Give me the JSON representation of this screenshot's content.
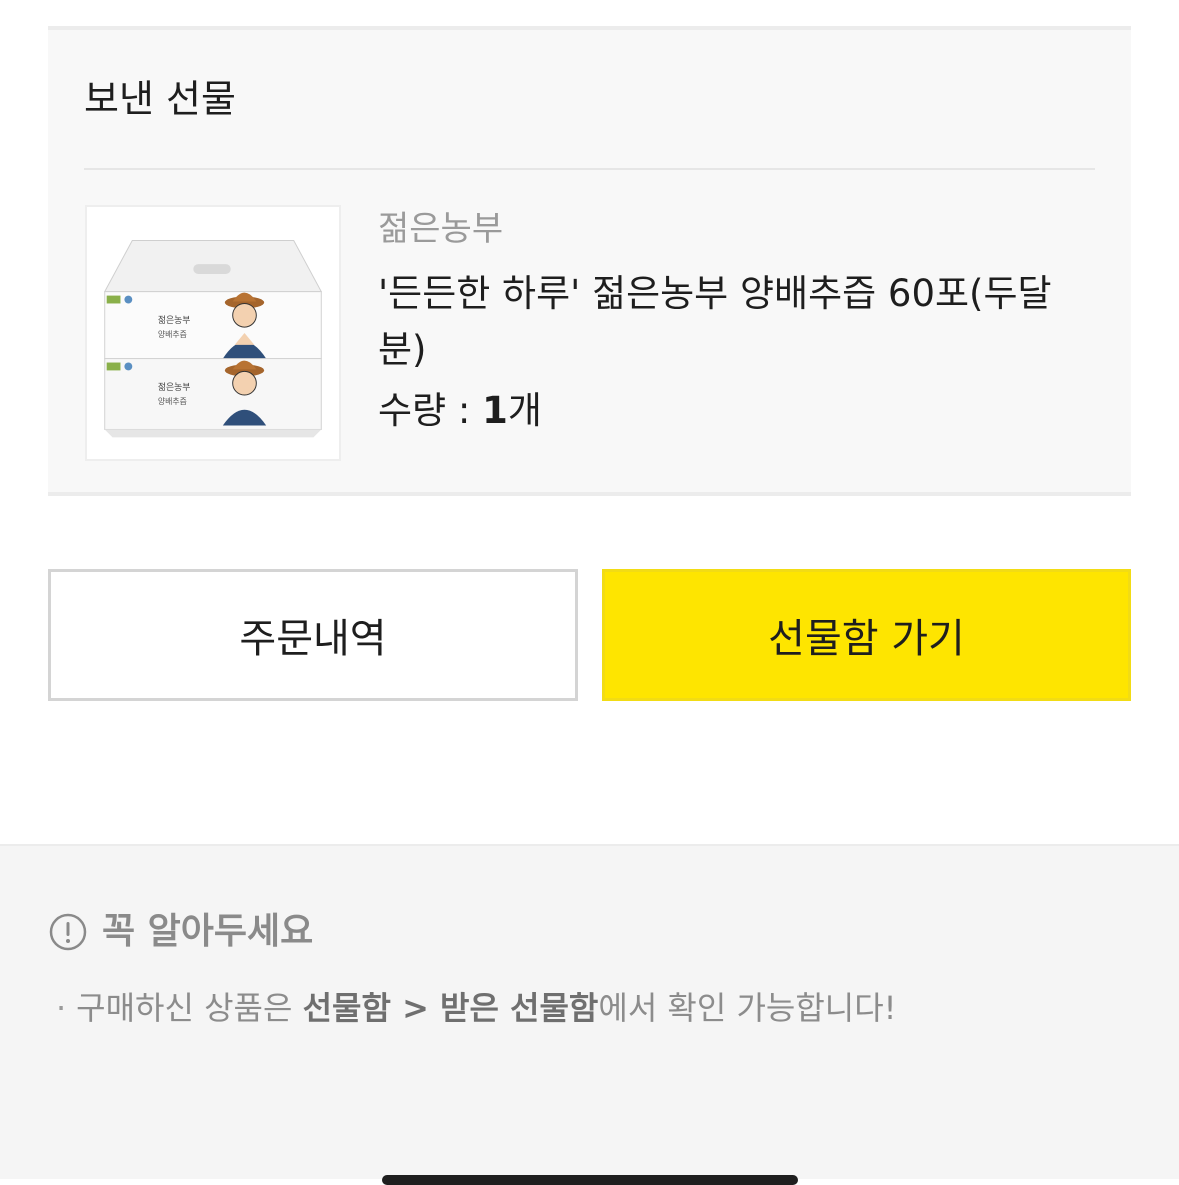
{
  "gift": {
    "section_title": "보낸 선물",
    "brand": "젊은농부",
    "product_name": "'든든한 하루' 젊은농부 양배추즙 60포(두달분)",
    "quantity_label": "수량 : ",
    "quantity_value": "1",
    "quantity_unit": "개",
    "package_text": {
      "brand": "젊은농부",
      "product": "양배추즙"
    }
  },
  "buttons": {
    "orders_label": "주문내역",
    "giftbox_label": "선물함 가기"
  },
  "notice": {
    "title": "꼭 알아두세요",
    "line_prefix": "구매하신 상품은 ",
    "line_bold1": "선물함 > 받은 선물함",
    "line_suffix": "에서 확인 가능합니다!"
  },
  "colors": {
    "primary_button": "#fee500",
    "background_gray": "#f5f5f5"
  },
  "icons": {
    "notice": "info-icon"
  }
}
